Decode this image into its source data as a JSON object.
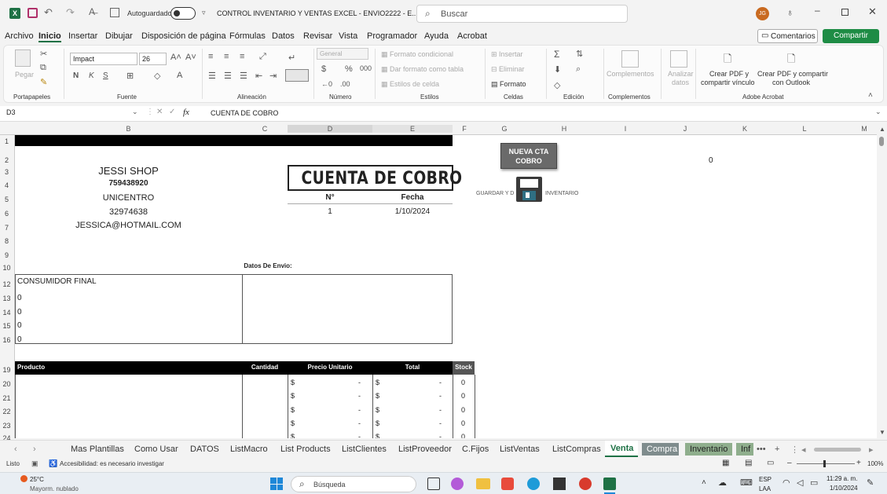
{
  "titlebar": {
    "autosave_label": "Autoguardado",
    "doc_title": "CONTROL INVENTARIO Y VENTAS EXCEL - ENVIO2222 - E...",
    "search_placeholder": "Buscar",
    "user_initials": "JG"
  },
  "menu": [
    "Archivo",
    "Inicio",
    "Insertar",
    "Dibujar",
    "Disposición de página",
    "Fórmulas",
    "Datos",
    "Revisar",
    "Vista",
    "Programador",
    "Ayuda",
    "Acrobat"
  ],
  "comments_label": "Comentarios",
  "share_label": "Compartir",
  "ribbon": {
    "clipboard": {
      "paste": "Pegar",
      "label": "Portapapeles"
    },
    "font": {
      "name": "Impact",
      "size": "26",
      "label": "Fuente"
    },
    "align": {
      "label": "Alineación"
    },
    "number": {
      "format": "General",
      "label": "Número"
    },
    "styles": {
      "cond": "Formato condicional",
      "table": "Dar formato como tabla",
      "cell": "Estilos de celda",
      "label": "Estilos"
    },
    "cells": {
      "insert": "Insertar",
      "delete": "Eliminar",
      "format": "Formato",
      "label": "Celdas"
    },
    "editing": {
      "label": "Edición"
    },
    "addins": {
      "btn": "Complementos",
      "label": "Complementos"
    },
    "analyze": {
      "l1": "Analizar",
      "l2": "datos"
    },
    "acrobat": {
      "pdf1a": "Crear PDF y",
      "pdf1b": "compartir vínculo",
      "pdf2a": "Crear PDF y compartir",
      "pdf2b": "con Outlook",
      "label": "Adobe Acrobat"
    }
  },
  "formula": {
    "namebox": "D3",
    "content": "CUENTA DE COBRO",
    "fx": "fx"
  },
  "columns": [
    "B",
    "C",
    "D",
    "E",
    "F",
    "G",
    "H",
    "I",
    "J",
    "K",
    "L",
    "M"
  ],
  "rows": [
    "1",
    "2",
    "3",
    "4",
    "5",
    "6",
    "7",
    "8",
    "9",
    "10",
    "12",
    "13",
    "14",
    "15",
    "16",
    "19",
    "20",
    "21",
    "22",
    "23",
    "24"
  ],
  "invoice": {
    "shop": "JESSI SHOP",
    "nit": "759438920",
    "place": "UNICENTRO",
    "phone": "32974638",
    "email": "JESSICA@HOTMAIL.COM",
    "title": "CUENTA DE COBRO",
    "no_label": "N°",
    "date_label": "Fecha",
    "no_value": "1",
    "date_value": "1/10/2024",
    "ship_label": "Datos De Envio:",
    "client": "CONSUMIDOR FINAL",
    "client_lines": [
      "0",
      "0",
      "0",
      "0"
    ],
    "table_headers": {
      "product": "Producto",
      "qty": "Cantidad",
      "unit": "Precio Unitario",
      "total": "Total",
      "stock": "Stock"
    },
    "currency": "$",
    "dash": "-",
    "stock_values": [
      "0",
      "0",
      "0",
      "0",
      "0"
    ]
  },
  "side": {
    "new_button": "NUEVA CTA COBRO",
    "j2_value": "0",
    "save_text_left": "GUARDAR Y D",
    "save_text_right": "INVENTARIO"
  },
  "sheets": [
    "Mas Plantillas",
    "Como Usar",
    "DATOS",
    "ListMacro",
    "List Products",
    "ListClientes",
    "ListProveedor",
    "C.Fijos",
    "ListVentas",
    "ListCompras",
    "Venta",
    "Compra",
    "Inventario",
    "Inf"
  ],
  "status": {
    "ready": "Listo",
    "accessibility": "Accesibilidad: es necesario investigar",
    "zoom": "100%"
  },
  "taskbar": {
    "temp": "25°C",
    "weather": "Mayorm. nublado",
    "search": "Búsqueda",
    "lang1": "ESP",
    "lang2": "LAA",
    "time": "11:29 a. m.",
    "date": "1/10/2024"
  },
  "colors": {
    "excel_green": "#1e7145",
    "share_green": "#1e8c45",
    "sheet_black": "#000000",
    "selected_tab": "#7f8c8d"
  }
}
